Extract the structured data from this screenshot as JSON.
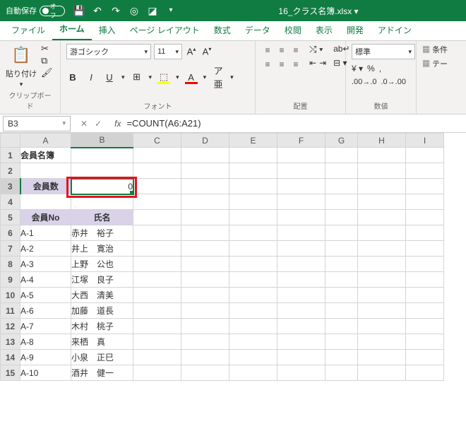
{
  "titlebar": {
    "autosave_label": "自動保存",
    "autosave_state": "オフ",
    "filename": "16_クラス名簿.xlsx"
  },
  "tabs": [
    "ファイル",
    "ホーム",
    "挿入",
    "ページ レイアウト",
    "数式",
    "データ",
    "校閲",
    "表示",
    "開発",
    "アドイン"
  ],
  "active_tab": 1,
  "ribbon": {
    "clipboard": {
      "paste": "貼り付け",
      "label": "クリップボード"
    },
    "font": {
      "name": "游ゴシック",
      "size": "11",
      "label": "フォント",
      "bold": "B",
      "italic": "I",
      "underline": "U"
    },
    "alignment": {
      "label": "配置"
    },
    "number": {
      "format": "標準",
      "label": "数値"
    },
    "cond_fmt": "条件",
    "table": "テー"
  },
  "namebox": "B3",
  "formula": "=COUNT(A6:A21)",
  "columns": [
    "A",
    "B",
    "C",
    "D",
    "E",
    "F",
    "G",
    "H",
    "I"
  ],
  "rows": [
    "1",
    "2",
    "3",
    "4",
    "5",
    "6",
    "7",
    "8",
    "9",
    "10",
    "11",
    "12",
    "13",
    "14",
    "15"
  ],
  "cells": {
    "A1": "会員名簿",
    "A3": "会員数",
    "B3": "0",
    "A5": "会員No",
    "B5": "氏名",
    "A6": "A-1",
    "B6": "赤井　裕子",
    "A7": "A-2",
    "B7": "井上　寛治",
    "A8": "A-3",
    "B8": "上野　公也",
    "A9": "A-4",
    "B9": "江塚　良子",
    "A10": "A-5",
    "B10": "大西　清美",
    "A11": "A-6",
    "B11": "加藤　道長",
    "A12": "A-7",
    "B12": "木村　桃子",
    "A13": "A-8",
    "B13": "来栖　真",
    "A14": "A-9",
    "B14": "小泉　正巳",
    "A15": "A-10",
    "B15": "酒井　健一"
  },
  "active_cell": "B3"
}
